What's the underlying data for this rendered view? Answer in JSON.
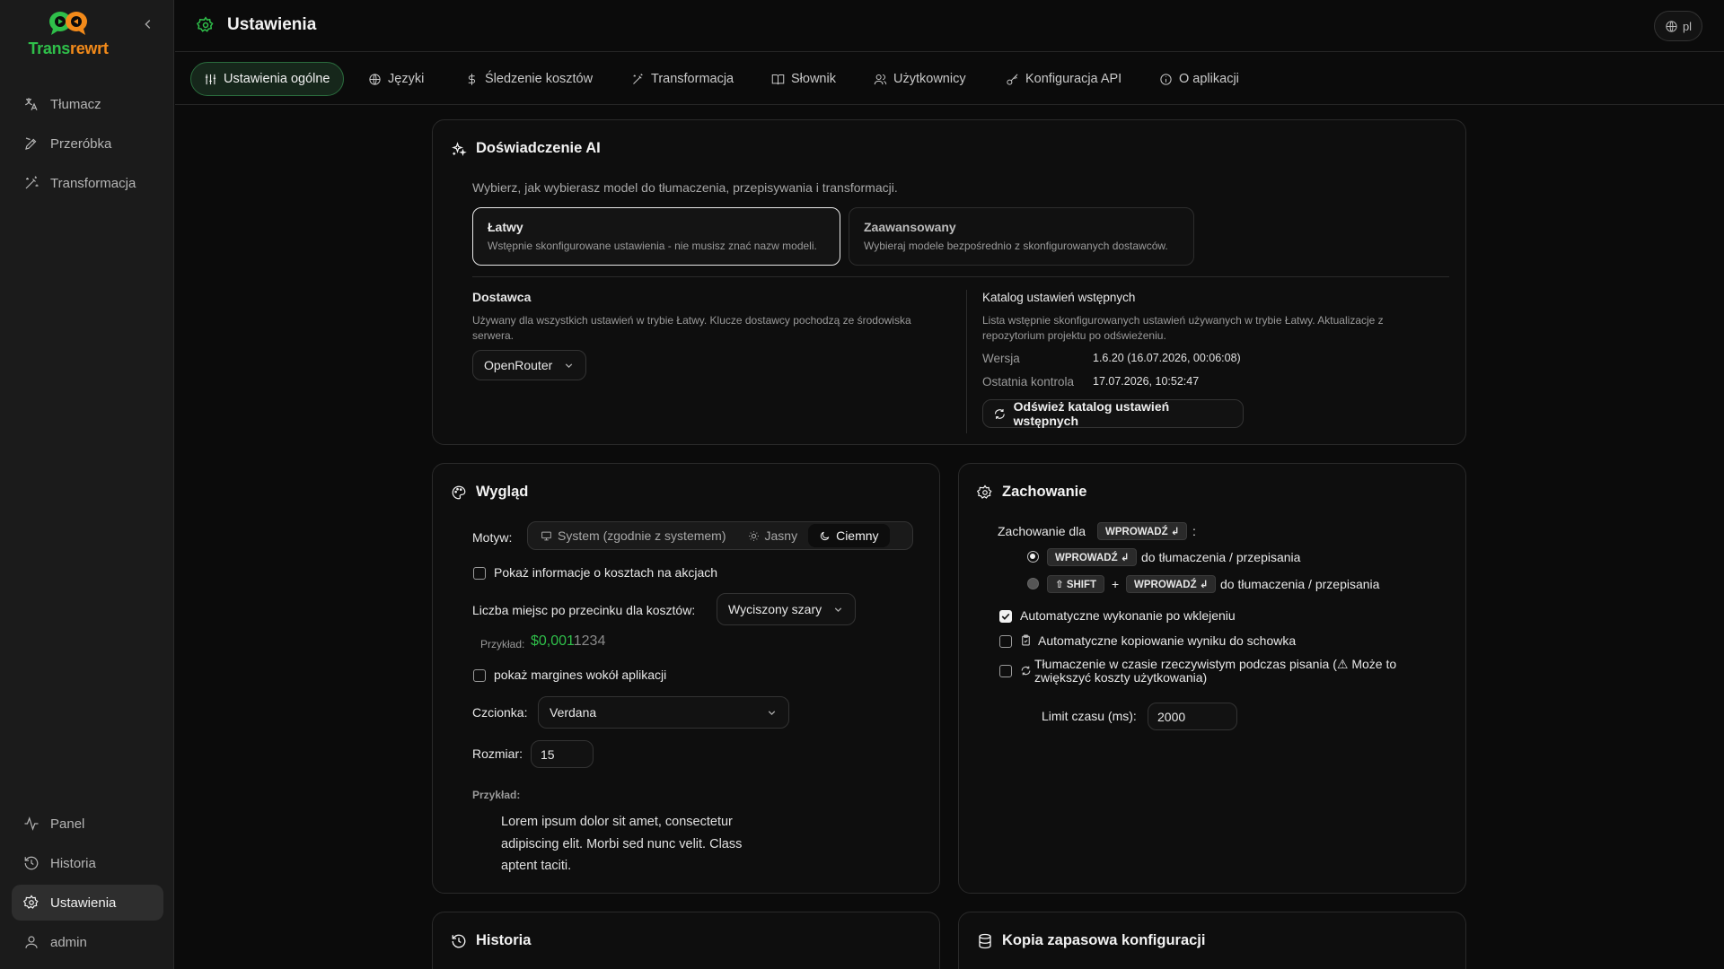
{
  "app": {
    "logo_a": "Trans",
    "logo_b": "rewrt",
    "page_title": "Ustawienia",
    "lang": "pl"
  },
  "sidebar": {
    "top_items": [
      {
        "label": "Tłumacz",
        "icon": "translate-icon"
      },
      {
        "label": "Przeróbka",
        "icon": "pen-icon"
      },
      {
        "label": "Transformacja",
        "icon": "wand-icon"
      }
    ],
    "bottom_items": [
      {
        "label": "Panel",
        "icon": "activity-icon"
      },
      {
        "label": "Historia",
        "icon": "history-icon"
      },
      {
        "label": "Ustawienia",
        "icon": "gear-icon",
        "active": true
      },
      {
        "label": "admin",
        "icon": "user-icon"
      }
    ]
  },
  "tabs": [
    {
      "label": "Ustawienia ogólne",
      "icon": "sliders-icon",
      "active": true
    },
    {
      "label": "Języki",
      "icon": "globe-icon"
    },
    {
      "label": "Śledzenie kosztów",
      "icon": "dollar-icon"
    },
    {
      "label": "Transformacja",
      "icon": "wand-icon"
    },
    {
      "label": "Słownik",
      "icon": "book-icon"
    },
    {
      "label": "Użytkownicy",
      "icon": "users-icon"
    },
    {
      "label": "Konfiguracja API",
      "icon": "key-icon"
    },
    {
      "label": "O aplikacji",
      "icon": "info-icon"
    }
  ],
  "ai": {
    "title": "Doświadczenie AI",
    "description": "Wybierz, jak wybierasz model do tłumaczenia, przepisywania i transformacji.",
    "easy_title": "Łatwy",
    "easy_desc": "Wstępnie skonfigurowane ustawienia - nie musisz znać nazw modeli.",
    "adv_title": "Zaawansowany",
    "adv_desc": "Wybieraj modele bezpośrednio z skonfigurowanych dostawców.",
    "provider_title": "Dostawca",
    "provider_desc": "Używany dla wszystkich ustawień w trybie Łatwy. Klucze dostawcy pochodzą ze środowiska serwera.",
    "provider_value": "OpenRouter",
    "catalog_title": "Katalog ustawień wstępnych",
    "catalog_desc": "Lista wstępnie skonfigurowanych ustawień używanych w trybie Łatwy. Aktualizacje z repozytorium projektu po odświeżeniu.",
    "version_label": "Wersja",
    "version_value": "1.6.20 (16.07.2026, 00:06:08)",
    "check_label": "Ostatnia kontrola",
    "check_value": "17.07.2026, 10:52:47",
    "refresh_label": "Odśwież katalog ustawień wstępnych"
  },
  "look": {
    "title": "Wygląd",
    "theme_label": "Motyw:",
    "theme_options": [
      "System (zgodnie z systemem)",
      "Jasny",
      "Ciemny"
    ],
    "theme_selected": "Ciemny",
    "show_costs": "Pokaż informacje o kosztach na akcjach",
    "decimals_label": "Liczba miejsc po przecinku dla kosztów:",
    "decimals_value": "Wyciszony szary",
    "example_label": "Przykład:",
    "example_bright": "$0,001",
    "example_dim": "1234",
    "show_margins": "pokaż margines wokół aplikacji",
    "font_label": "Czcionka:",
    "font_value": "Verdana",
    "size_label": "Rozmiar:",
    "size_value": "15",
    "preview_label": "Przykład:",
    "preview_text": "Lorem ipsum dolor sit amet, consectetur adipiscing elit. Morbi sed nunc velit. Class aptent taciti."
  },
  "behavior": {
    "title": "Zachowanie",
    "enter_for": "Zachowanie dla",
    "enter_key": "WPROWADŹ ↲",
    "colon": ":",
    "opt1_text": "do tłumaczenia / przepisania",
    "shift_key": "⇧ SHIFT",
    "plus": "+",
    "opt2_text": "do tłumaczenia / przepisania",
    "auto_run": "Automatyczne wykonanie po wklejeniu",
    "auto_copy": "Automatyczne kopiowanie wyniku do schowka",
    "realtime": "Tłumaczenie w czasie rzeczywistym podczas pisania (⚠ Może to zwiększyć koszty użytkowania)",
    "timeout_label": "Limit czasu (ms):",
    "timeout_value": "2000"
  },
  "history": {
    "title": "Historia"
  },
  "backup": {
    "title": "Kopia zapasowa konfiguracji"
  },
  "colors": {
    "accent_green": "#2fbf4a",
    "accent_orange": "#f28a1a"
  }
}
